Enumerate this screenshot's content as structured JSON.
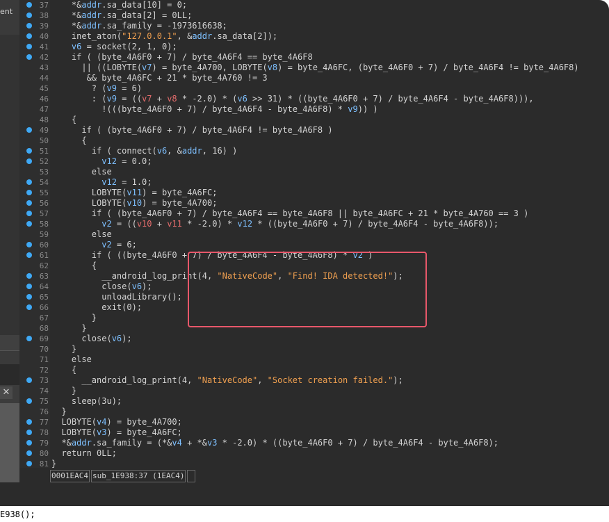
{
  "sidebar": {
    "label": "ent",
    "close_label": "✕"
  },
  "statusbar": {
    "address": "0001EAC4",
    "location": "sub_1E938:37 (1EAC4)"
  },
  "bottom": {
    "text": "E938();"
  },
  "highlight": {
    "color": "#e8576a"
  },
  "colors": {
    "variable": "#e76d6d",
    "global": "#7ec0ff",
    "string": "#f0a050",
    "plain": "#d4d4d4",
    "breakpoint": "#3fa9f5"
  },
  "lines": [
    {
      "n": "37",
      "bp": true,
      "t": [
        [
          "p",
          "    *&"
        ],
        [
          "g",
          "addr"
        ],
        [
          "p",
          ".sa_data[10] = 0;"
        ]
      ]
    },
    {
      "n": "38",
      "bp": true,
      "t": [
        [
          "p",
          "    *&"
        ],
        [
          "g",
          "addr"
        ],
        [
          "p",
          ".sa_data[2] = 0LL;"
        ]
      ]
    },
    {
      "n": "39",
      "bp": true,
      "t": [
        [
          "p",
          "    *&"
        ],
        [
          "g",
          "addr"
        ],
        [
          "p",
          ".sa_family = -1973616638;"
        ]
      ]
    },
    {
      "n": "40",
      "bp": true,
      "t": [
        [
          "p",
          "    inet_aton("
        ],
        [
          "s",
          "\"127.0.0.1\""
        ],
        [
          "p",
          ", &"
        ],
        [
          "g",
          "addr"
        ],
        [
          "p",
          ".sa_data[2]);"
        ]
      ]
    },
    {
      "n": "41",
      "bp": true,
      "t": [
        [
          "g",
          "    v6"
        ],
        [
          "p",
          " = socket(2, 1, 0);"
        ]
      ]
    },
    {
      "n": "42",
      "bp": true,
      "t": [
        [
          "p",
          "    if ( (byte_4A6F0 + 7) / byte_4A6F4 == byte_4A6F8"
        ]
      ]
    },
    {
      "n": "43",
      "bp": false,
      "t": [
        [
          "p",
          "      || ((LOBYTE("
        ],
        [
          "g",
          "v7"
        ],
        [
          "p",
          ") = byte_4A700, LOBYTE("
        ],
        [
          "g",
          "v8"
        ],
        [
          "p",
          ") = byte_4A6FC, (byte_4A6F0 + 7) / byte_4A6F4 != byte_4A6F8)"
        ]
      ]
    },
    {
      "n": "44",
      "bp": false,
      "t": [
        [
          "p",
          "       && byte_4A6FC + 21 * byte_4A760 != 3"
        ]
      ]
    },
    {
      "n": "45",
      "bp": false,
      "t": [
        [
          "p",
          "        ? ("
        ],
        [
          "g",
          "v9"
        ],
        [
          "p",
          " = 6)"
        ]
      ]
    },
    {
      "n": "46",
      "bp": false,
      "t": [
        [
          "p",
          "        : ("
        ],
        [
          "g",
          "v9"
        ],
        [
          "p",
          " = (("
        ],
        [
          "v",
          "v7"
        ],
        [
          "p",
          " + "
        ],
        [
          "v",
          "v8"
        ],
        [
          "p",
          " * -2.0) * ("
        ],
        [
          "g",
          "v6"
        ],
        [
          "p",
          " >> 31) * ((byte_4A6F0 + 7) / byte_4A6F4 - byte_4A6F8))),"
        ]
      ]
    },
    {
      "n": "47",
      "bp": false,
      "t": [
        [
          "p",
          "          !(((byte_4A6F0 + 7) / byte_4A6F4 - byte_4A6F8) * "
        ],
        [
          "g",
          "v9"
        ],
        [
          "p",
          ")) )"
        ]
      ]
    },
    {
      "n": "48",
      "bp": false,
      "t": [
        [
          "p",
          "    {"
        ]
      ]
    },
    {
      "n": "49",
      "bp": true,
      "t": [
        [
          "p",
          "      if ( (byte_4A6F0 + 7) / byte_4A6F4 != byte_4A6F8 )"
        ]
      ]
    },
    {
      "n": "50",
      "bp": false,
      "t": [
        [
          "p",
          "      {"
        ]
      ]
    },
    {
      "n": "51",
      "bp": true,
      "t": [
        [
          "p",
          "        if ( connect("
        ],
        [
          "g",
          "v6"
        ],
        [
          "p",
          ", &"
        ],
        [
          "g",
          "addr"
        ],
        [
          "p",
          ", 16) )"
        ]
      ]
    },
    {
      "n": "52",
      "bp": true,
      "t": [
        [
          "g",
          "          v12"
        ],
        [
          "p",
          " = 0.0;"
        ]
      ]
    },
    {
      "n": "53",
      "bp": false,
      "t": [
        [
          "p",
          "        else"
        ]
      ]
    },
    {
      "n": "54",
      "bp": true,
      "t": [
        [
          "g",
          "          v12"
        ],
        [
          "p",
          " = 1.0;"
        ]
      ]
    },
    {
      "n": "55",
      "bp": true,
      "t": [
        [
          "p",
          "        LOBYTE("
        ],
        [
          "g",
          "v11"
        ],
        [
          "p",
          ") = byte_4A6FC;"
        ]
      ]
    },
    {
      "n": "56",
      "bp": true,
      "t": [
        [
          "p",
          "        LOBYTE("
        ],
        [
          "g",
          "v10"
        ],
        [
          "p",
          ") = byte_4A700;"
        ]
      ]
    },
    {
      "n": "57",
      "bp": true,
      "t": [
        [
          "p",
          "        if ( (byte_4A6F0 + 7) / byte_4A6F4 == byte_4A6F8 || byte_4A6FC + 21 * byte_4A760 == 3 )"
        ]
      ]
    },
    {
      "n": "58",
      "bp": true,
      "t": [
        [
          "g",
          "          v2"
        ],
        [
          "p",
          " = (("
        ],
        [
          "v",
          "v10"
        ],
        [
          "p",
          " + "
        ],
        [
          "v",
          "v11"
        ],
        [
          "p",
          " * -2.0) * "
        ],
        [
          "g",
          "v12"
        ],
        [
          "p",
          " * ((byte_4A6F0 + 7) / byte_4A6F4 - byte_4A6F8));"
        ]
      ]
    },
    {
      "n": "59",
      "bp": false,
      "t": [
        [
          "p",
          "        else"
        ]
      ]
    },
    {
      "n": "60",
      "bp": true,
      "t": [
        [
          "g",
          "          v2"
        ],
        [
          "p",
          " = 6;"
        ]
      ]
    },
    {
      "n": "61",
      "bp": true,
      "t": [
        [
          "p",
          "        if ( ((byte_4A6F0 + 7) / byte_4A6F4 - byte_4A6F8) * "
        ],
        [
          "g",
          "v2"
        ],
        [
          "p",
          " )"
        ]
      ]
    },
    {
      "n": "62",
      "bp": false,
      "t": [
        [
          "p",
          "        {"
        ]
      ]
    },
    {
      "n": "63",
      "bp": true,
      "t": [
        [
          "p",
          "          __android_log_print(4, "
        ],
        [
          "s",
          "\"NativeCode\""
        ],
        [
          "p",
          ", "
        ],
        [
          "s",
          "\"Find! IDA detected!\""
        ],
        [
          "p",
          ");"
        ]
      ]
    },
    {
      "n": "64",
      "bp": true,
      "t": [
        [
          "p",
          "          close("
        ],
        [
          "g",
          "v6"
        ],
        [
          "p",
          ");"
        ]
      ]
    },
    {
      "n": "65",
      "bp": true,
      "t": [
        [
          "p",
          "          unloadLibrary();"
        ]
      ]
    },
    {
      "n": "66",
      "bp": true,
      "t": [
        [
          "p",
          "          exit(0);"
        ]
      ]
    },
    {
      "n": "67",
      "bp": false,
      "t": [
        [
          "p",
          "        }"
        ]
      ]
    },
    {
      "n": "68",
      "bp": false,
      "t": [
        [
          "p",
          "      }"
        ]
      ]
    },
    {
      "n": "69",
      "bp": true,
      "t": [
        [
          "p",
          "      close("
        ],
        [
          "g",
          "v6"
        ],
        [
          "p",
          ");"
        ]
      ]
    },
    {
      "n": "70",
      "bp": false,
      "t": [
        [
          "p",
          "    }"
        ]
      ]
    },
    {
      "n": "71",
      "bp": false,
      "t": [
        [
          "p",
          "    else"
        ]
      ]
    },
    {
      "n": "72",
      "bp": false,
      "t": [
        [
          "p",
          "    {"
        ]
      ]
    },
    {
      "n": "73",
      "bp": true,
      "t": [
        [
          "p",
          "      __android_log_print(4, "
        ],
        [
          "s",
          "\"NativeCode\""
        ],
        [
          "p",
          ", "
        ],
        [
          "s",
          "\"Socket creation failed.\""
        ],
        [
          "p",
          ");"
        ]
      ]
    },
    {
      "n": "74",
      "bp": false,
      "t": [
        [
          "p",
          "    }"
        ]
      ]
    },
    {
      "n": "75",
      "bp": true,
      "t": [
        [
          "p",
          "    sleep(3u);"
        ]
      ]
    },
    {
      "n": "76",
      "bp": false,
      "t": [
        [
          "p",
          "  }"
        ]
      ]
    },
    {
      "n": "77",
      "bp": true,
      "t": [
        [
          "p",
          "  LOBYTE("
        ],
        [
          "g",
          "v4"
        ],
        [
          "p",
          ") = byte_4A700;"
        ]
      ]
    },
    {
      "n": "78",
      "bp": true,
      "t": [
        [
          "p",
          "  LOBYTE("
        ],
        [
          "g",
          "v3"
        ],
        [
          "p",
          ") = byte_4A6FC;"
        ]
      ]
    },
    {
      "n": "79",
      "bp": true,
      "t": [
        [
          "p",
          "  *&"
        ],
        [
          "g",
          "addr"
        ],
        [
          "p",
          ".sa_family = (*&"
        ],
        [
          "g",
          "v4"
        ],
        [
          "p",
          " + *&"
        ],
        [
          "g",
          "v3"
        ],
        [
          "p",
          " * -2.0) * ((byte_4A6F0 + 7) / byte_4A6F4 - byte_4A6F8);"
        ]
      ]
    },
    {
      "n": "80",
      "bp": true,
      "t": [
        [
          "p",
          "  return 0LL;"
        ]
      ]
    },
    {
      "n": "81",
      "bp": true,
      "t": [
        [
          "p",
          "}"
        ]
      ]
    }
  ]
}
